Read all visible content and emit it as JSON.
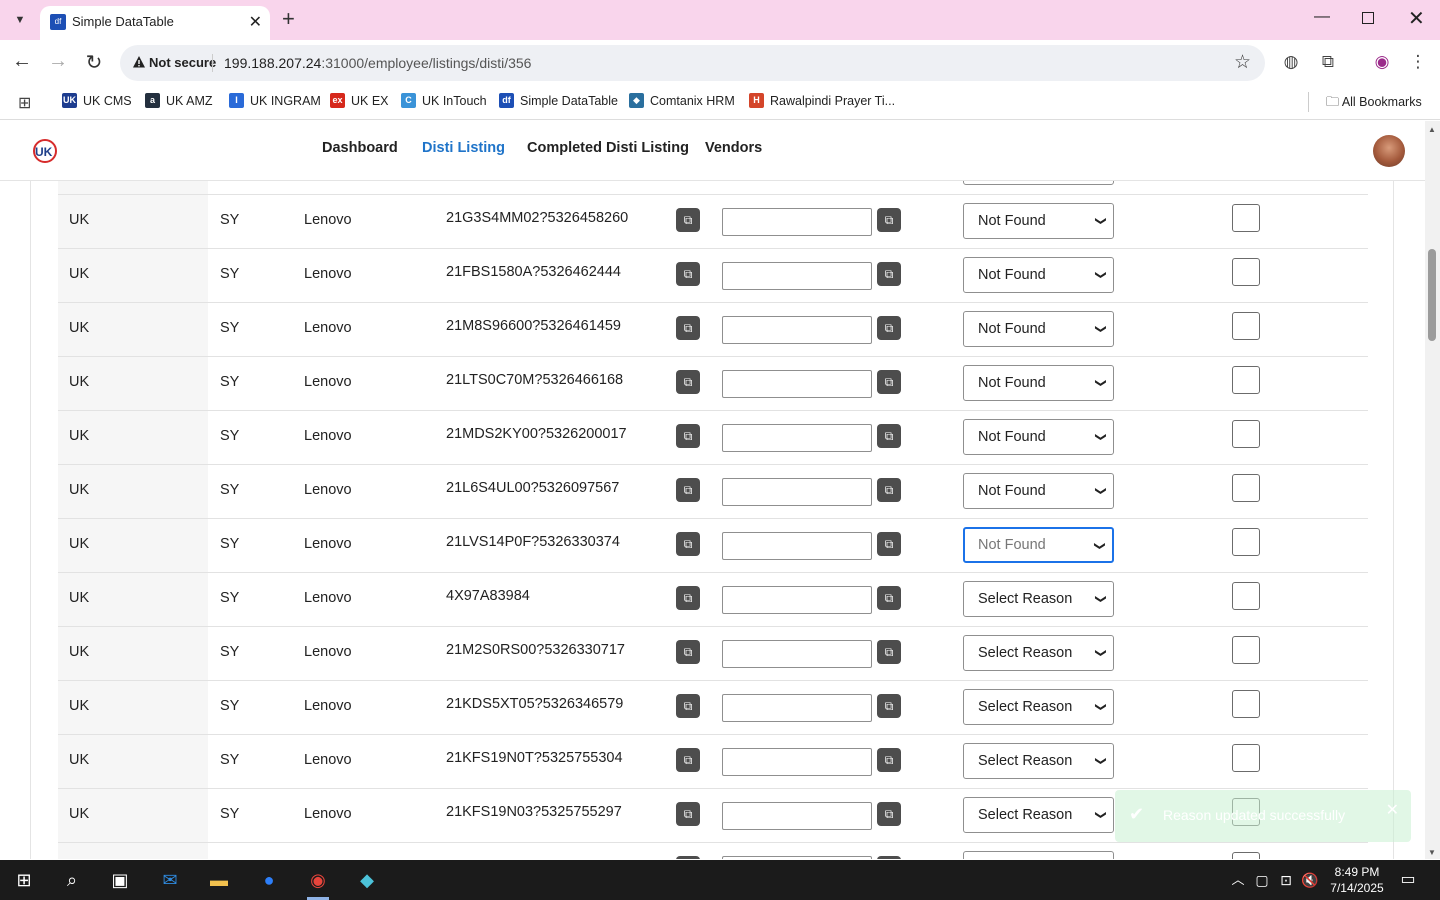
{
  "browser": {
    "tab_title": "Simple DataTable",
    "tab_favicon": "df",
    "security_label": "Not secure",
    "url_host": "199.188.207.24",
    "url_rest": ":31000/employee/listings/disti/356",
    "bookmarks": [
      {
        "label": "UK CMS",
        "icon_color": "#1d3c8f",
        "icon_text": "UK"
      },
      {
        "label": "UK AMZ",
        "icon_color": "#232f3e",
        "icon_text": "a"
      },
      {
        "label": "UK INGRAM",
        "icon_color": "#2a6ad8",
        "icon_text": "I"
      },
      {
        "label": "UK EX",
        "icon_color": "#d6281b",
        "icon_text": "ex"
      },
      {
        "label": "UK InTouch",
        "icon_color": "#3a93d8",
        "icon_text": "C"
      },
      {
        "label": "Simple DataTable",
        "icon_color": "#1d4fb5",
        "icon_text": "df"
      },
      {
        "label": "Comtanix HRM",
        "icon_color": "#2a6f9e",
        "icon_text": "◆"
      },
      {
        "label": "Rawalpindi Prayer Ti...",
        "icon_color": "#d4452a",
        "icon_text": "H"
      }
    ],
    "all_bookmarks_label": "All Bookmarks"
  },
  "app": {
    "logo_text": "UK",
    "nav": [
      {
        "label": "Dashboard",
        "active": false
      },
      {
        "label": "Disti Listing",
        "active": true
      },
      {
        "label": "Completed Disti Listing",
        "active": false
      },
      {
        "label": "Vendors",
        "active": false
      }
    ]
  },
  "table": {
    "rows": [
      {
        "region": "UK",
        "code": "SY",
        "brand": "Lenovo",
        "sku": "21G3S4MM02?5326458260",
        "input_value": "",
        "reason": "Not Found",
        "checked": false
      },
      {
        "region": "UK",
        "code": "SY",
        "brand": "Lenovo",
        "sku": "21FBS1580A?5326462444",
        "input_value": "",
        "reason": "Not Found",
        "checked": false
      },
      {
        "region": "UK",
        "code": "SY",
        "brand": "Lenovo",
        "sku": "21M8S96600?5326461459",
        "input_value": "",
        "reason": "Not Found",
        "checked": false
      },
      {
        "region": "UK",
        "code": "SY",
        "brand": "Lenovo",
        "sku": "21LTS0C70M?5326466168",
        "input_value": "",
        "reason": "Not Found",
        "checked": false
      },
      {
        "region": "UK",
        "code": "SY",
        "brand": "Lenovo",
        "sku": "21MDS2KY00?5326200017",
        "input_value": "",
        "reason": "Not Found",
        "checked": false
      },
      {
        "region": "UK",
        "code": "SY",
        "brand": "Lenovo",
        "sku": "21L6S4UL00?5326097567",
        "input_value": "",
        "reason": "Not Found",
        "checked": false
      },
      {
        "region": "UK",
        "code": "SY",
        "brand": "Lenovo",
        "sku": "21LVS14P0F?5326330374",
        "input_value": "",
        "reason": "Not Found",
        "checked": false,
        "focused": true
      },
      {
        "region": "UK",
        "code": "SY",
        "brand": "Lenovo",
        "sku": "4X97A83984",
        "input_value": "",
        "reason": "Select Reason",
        "checked": false
      },
      {
        "region": "UK",
        "code": "SY",
        "brand": "Lenovo",
        "sku": "21M2S0RS00?5326330717",
        "input_value": "",
        "reason": "Select Reason",
        "checked": false
      },
      {
        "region": "UK",
        "code": "SY",
        "brand": "Lenovo",
        "sku": "21KDS5XT05?5326346579",
        "input_value": "",
        "reason": "Select Reason",
        "checked": false
      },
      {
        "region": "UK",
        "code": "SY",
        "brand": "Lenovo",
        "sku": "21KFS19N0T?5325755304",
        "input_value": "",
        "reason": "Select Reason",
        "checked": false
      },
      {
        "region": "UK",
        "code": "SY",
        "brand": "Lenovo",
        "sku": "21KFS19N03?5325755297",
        "input_value": "",
        "reason": "Select Reason",
        "checked": false
      }
    ]
  },
  "toast": {
    "message": "Reason updated successfully"
  },
  "taskbar": {
    "time": "8:49 PM",
    "date": "7/14/2025"
  }
}
